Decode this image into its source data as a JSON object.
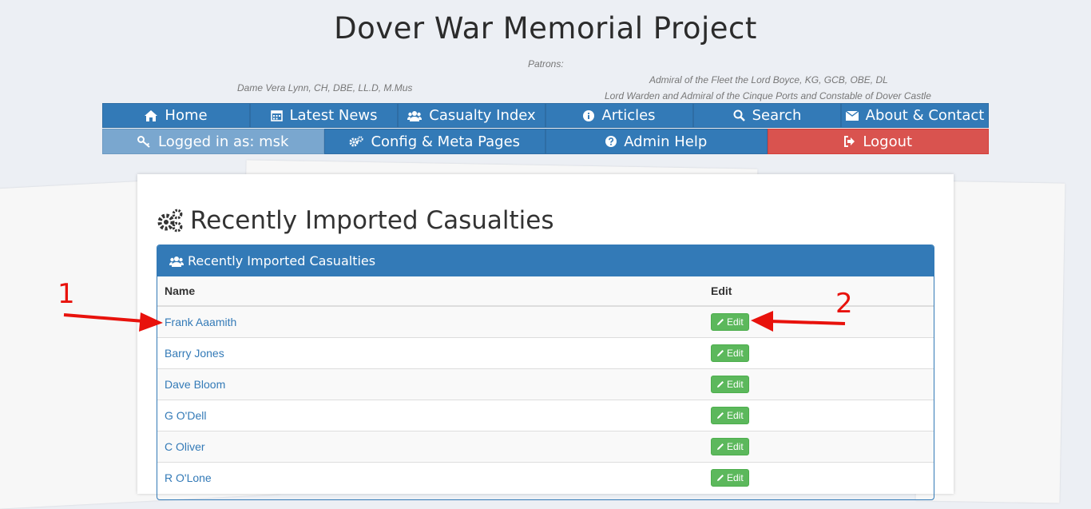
{
  "site": {
    "title": "Dover War Memorial Project",
    "patrons_label": "Patrons:",
    "patron_left": "Dame Vera Lynn, CH, DBE, LL.D, M.Mus",
    "patron_right_1": "Admiral of the Fleet the Lord Boyce, KG, GCB, OBE, DL",
    "patron_right_2": "Lord Warden and Admiral of the Cinque Ports and Constable of Dover Castle"
  },
  "nav_main": [
    {
      "label": "Home",
      "icon": "home-icon"
    },
    {
      "label": "Latest News",
      "icon": "calendar-icon"
    },
    {
      "label": "Casualty Index",
      "icon": "users-icon"
    },
    {
      "label": "Articles",
      "icon": "info-icon"
    },
    {
      "label": "Search",
      "icon": "search-icon"
    },
    {
      "label": "About & Contact",
      "icon": "envelope-icon"
    }
  ],
  "nav_admin": [
    {
      "label": "Logged in as: msk",
      "icon": "key-icon"
    },
    {
      "label": "Config & Meta Pages",
      "icon": "cogs-icon"
    },
    {
      "label": "Admin Help",
      "icon": "question-icon"
    },
    {
      "label": "Logout",
      "icon": "logout-icon"
    }
  ],
  "page": {
    "heading": "Recently Imported Casualties"
  },
  "panel": {
    "title": "Recently Imported Casualties",
    "columns": {
      "name": "Name",
      "edit": "Edit"
    },
    "edit_label": "Edit",
    "rows": [
      {
        "name": "Frank Aaamith"
      },
      {
        "name": "Barry Jones"
      },
      {
        "name": "Dave Bloom"
      },
      {
        "name": "G O'Dell"
      },
      {
        "name": "C Oliver"
      },
      {
        "name": "R O'Lone"
      }
    ]
  },
  "annotations": {
    "marker_1": "1",
    "marker_2": "2",
    "color": "#e8120c"
  },
  "colors": {
    "primary": "#337ab7",
    "danger": "#d9534f",
    "success": "#5cb85c"
  }
}
